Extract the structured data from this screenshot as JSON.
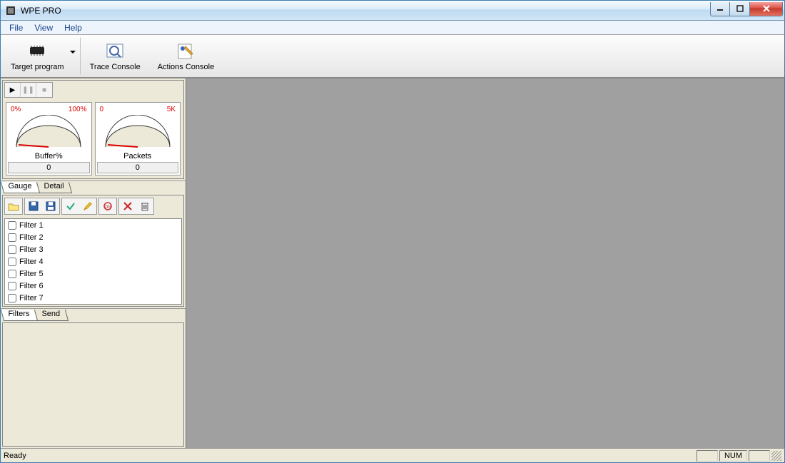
{
  "window": {
    "title": "WPE PRO"
  },
  "menu": {
    "file": "File",
    "view": "View",
    "help": "Help"
  },
  "toolbar": {
    "target_program": "Target program",
    "trace_console": "Trace Console",
    "actions_console": "Actions Console"
  },
  "gauges": {
    "buffer": {
      "min": "0%",
      "max": "100%",
      "label": "Buffer%",
      "value": "0"
    },
    "packets": {
      "min": "0",
      "max": "5K",
      "label": "Packets",
      "value": "0"
    }
  },
  "gauge_tabs": {
    "gauge": "Gauge",
    "detail": "Detail"
  },
  "filters": [
    "Filter 1",
    "Filter 2",
    "Filter 3",
    "Filter 4",
    "Filter 5",
    "Filter 6",
    "Filter 7"
  ],
  "filter_tabs": {
    "filters": "Filters",
    "send": "Send"
  },
  "status": {
    "ready": "Ready",
    "num": "NUM"
  }
}
